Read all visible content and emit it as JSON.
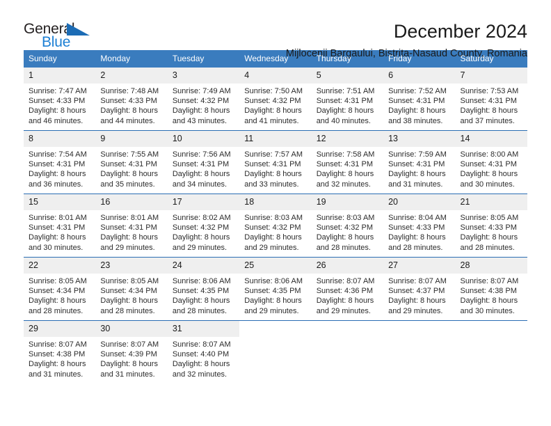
{
  "brand": {
    "name_part1": "General",
    "name_part2": "Blue",
    "flag_icon": "blue-flag-triangle-icon",
    "accent_color": "#1c7fd4"
  },
  "header": {
    "title": "December 2024",
    "subtitle": "Mijlocenii Bargaului, Bistrita-Nasaud County, Romania"
  },
  "colors": {
    "header_row_background": "#3a7cbe",
    "header_row_text": "#ffffff",
    "day_number_background": "#efefef",
    "row_divider": "#2a6db3",
    "body_text": "#2b2b2b"
  },
  "weekday_headers": [
    "Sunday",
    "Monday",
    "Tuesday",
    "Wednesday",
    "Thursday",
    "Friday",
    "Saturday"
  ],
  "weeks": [
    [
      {
        "day": "1",
        "sunrise": "Sunrise: 7:47 AM",
        "sunset": "Sunset: 4:33 PM",
        "daylight1": "Daylight: 8 hours",
        "daylight2": "and 46 minutes."
      },
      {
        "day": "2",
        "sunrise": "Sunrise: 7:48 AM",
        "sunset": "Sunset: 4:33 PM",
        "daylight1": "Daylight: 8 hours",
        "daylight2": "and 44 minutes."
      },
      {
        "day": "3",
        "sunrise": "Sunrise: 7:49 AM",
        "sunset": "Sunset: 4:32 PM",
        "daylight1": "Daylight: 8 hours",
        "daylight2": "and 43 minutes."
      },
      {
        "day": "4",
        "sunrise": "Sunrise: 7:50 AM",
        "sunset": "Sunset: 4:32 PM",
        "daylight1": "Daylight: 8 hours",
        "daylight2": "and 41 minutes."
      },
      {
        "day": "5",
        "sunrise": "Sunrise: 7:51 AM",
        "sunset": "Sunset: 4:31 PM",
        "daylight1": "Daylight: 8 hours",
        "daylight2": "and 40 minutes."
      },
      {
        "day": "6",
        "sunrise": "Sunrise: 7:52 AM",
        "sunset": "Sunset: 4:31 PM",
        "daylight1": "Daylight: 8 hours",
        "daylight2": "and 38 minutes."
      },
      {
        "day": "7",
        "sunrise": "Sunrise: 7:53 AM",
        "sunset": "Sunset: 4:31 PM",
        "daylight1": "Daylight: 8 hours",
        "daylight2": "and 37 minutes."
      }
    ],
    [
      {
        "day": "8",
        "sunrise": "Sunrise: 7:54 AM",
        "sunset": "Sunset: 4:31 PM",
        "daylight1": "Daylight: 8 hours",
        "daylight2": "and 36 minutes."
      },
      {
        "day": "9",
        "sunrise": "Sunrise: 7:55 AM",
        "sunset": "Sunset: 4:31 PM",
        "daylight1": "Daylight: 8 hours",
        "daylight2": "and 35 minutes."
      },
      {
        "day": "10",
        "sunrise": "Sunrise: 7:56 AM",
        "sunset": "Sunset: 4:31 PM",
        "daylight1": "Daylight: 8 hours",
        "daylight2": "and 34 minutes."
      },
      {
        "day": "11",
        "sunrise": "Sunrise: 7:57 AM",
        "sunset": "Sunset: 4:31 PM",
        "daylight1": "Daylight: 8 hours",
        "daylight2": "and 33 minutes."
      },
      {
        "day": "12",
        "sunrise": "Sunrise: 7:58 AM",
        "sunset": "Sunset: 4:31 PM",
        "daylight1": "Daylight: 8 hours",
        "daylight2": "and 32 minutes."
      },
      {
        "day": "13",
        "sunrise": "Sunrise: 7:59 AM",
        "sunset": "Sunset: 4:31 PM",
        "daylight1": "Daylight: 8 hours",
        "daylight2": "and 31 minutes."
      },
      {
        "day": "14",
        "sunrise": "Sunrise: 8:00 AM",
        "sunset": "Sunset: 4:31 PM",
        "daylight1": "Daylight: 8 hours",
        "daylight2": "and 30 minutes."
      }
    ],
    [
      {
        "day": "15",
        "sunrise": "Sunrise: 8:01 AM",
        "sunset": "Sunset: 4:31 PM",
        "daylight1": "Daylight: 8 hours",
        "daylight2": "and 30 minutes."
      },
      {
        "day": "16",
        "sunrise": "Sunrise: 8:01 AM",
        "sunset": "Sunset: 4:31 PM",
        "daylight1": "Daylight: 8 hours",
        "daylight2": "and 29 minutes."
      },
      {
        "day": "17",
        "sunrise": "Sunrise: 8:02 AM",
        "sunset": "Sunset: 4:32 PM",
        "daylight1": "Daylight: 8 hours",
        "daylight2": "and 29 minutes."
      },
      {
        "day": "18",
        "sunrise": "Sunrise: 8:03 AM",
        "sunset": "Sunset: 4:32 PM",
        "daylight1": "Daylight: 8 hours",
        "daylight2": "and 29 minutes."
      },
      {
        "day": "19",
        "sunrise": "Sunrise: 8:03 AM",
        "sunset": "Sunset: 4:32 PM",
        "daylight1": "Daylight: 8 hours",
        "daylight2": "and 28 minutes."
      },
      {
        "day": "20",
        "sunrise": "Sunrise: 8:04 AM",
        "sunset": "Sunset: 4:33 PM",
        "daylight1": "Daylight: 8 hours",
        "daylight2": "and 28 minutes."
      },
      {
        "day": "21",
        "sunrise": "Sunrise: 8:05 AM",
        "sunset": "Sunset: 4:33 PM",
        "daylight1": "Daylight: 8 hours",
        "daylight2": "and 28 minutes."
      }
    ],
    [
      {
        "day": "22",
        "sunrise": "Sunrise: 8:05 AM",
        "sunset": "Sunset: 4:34 PM",
        "daylight1": "Daylight: 8 hours",
        "daylight2": "and 28 minutes."
      },
      {
        "day": "23",
        "sunrise": "Sunrise: 8:05 AM",
        "sunset": "Sunset: 4:34 PM",
        "daylight1": "Daylight: 8 hours",
        "daylight2": "and 28 minutes."
      },
      {
        "day": "24",
        "sunrise": "Sunrise: 8:06 AM",
        "sunset": "Sunset: 4:35 PM",
        "daylight1": "Daylight: 8 hours",
        "daylight2": "and 28 minutes."
      },
      {
        "day": "25",
        "sunrise": "Sunrise: 8:06 AM",
        "sunset": "Sunset: 4:35 PM",
        "daylight1": "Daylight: 8 hours",
        "daylight2": "and 29 minutes."
      },
      {
        "day": "26",
        "sunrise": "Sunrise: 8:07 AM",
        "sunset": "Sunset: 4:36 PM",
        "daylight1": "Daylight: 8 hours",
        "daylight2": "and 29 minutes."
      },
      {
        "day": "27",
        "sunrise": "Sunrise: 8:07 AM",
        "sunset": "Sunset: 4:37 PM",
        "daylight1": "Daylight: 8 hours",
        "daylight2": "and 29 minutes."
      },
      {
        "day": "28",
        "sunrise": "Sunrise: 8:07 AM",
        "sunset": "Sunset: 4:38 PM",
        "daylight1": "Daylight: 8 hours",
        "daylight2": "and 30 minutes."
      }
    ],
    [
      {
        "day": "29",
        "sunrise": "Sunrise: 8:07 AM",
        "sunset": "Sunset: 4:38 PM",
        "daylight1": "Daylight: 8 hours",
        "daylight2": "and 31 minutes."
      },
      {
        "day": "30",
        "sunrise": "Sunrise: 8:07 AM",
        "sunset": "Sunset: 4:39 PM",
        "daylight1": "Daylight: 8 hours",
        "daylight2": "and 31 minutes."
      },
      {
        "day": "31",
        "sunrise": "Sunrise: 8:07 AM",
        "sunset": "Sunset: 4:40 PM",
        "daylight1": "Daylight: 8 hours",
        "daylight2": "and 32 minutes."
      },
      {
        "day": "",
        "sunrise": "",
        "sunset": "",
        "daylight1": "",
        "daylight2": ""
      },
      {
        "day": "",
        "sunrise": "",
        "sunset": "",
        "daylight1": "",
        "daylight2": ""
      },
      {
        "day": "",
        "sunrise": "",
        "sunset": "",
        "daylight1": "",
        "daylight2": ""
      },
      {
        "day": "",
        "sunrise": "",
        "sunset": "",
        "daylight1": "",
        "daylight2": ""
      }
    ]
  ]
}
